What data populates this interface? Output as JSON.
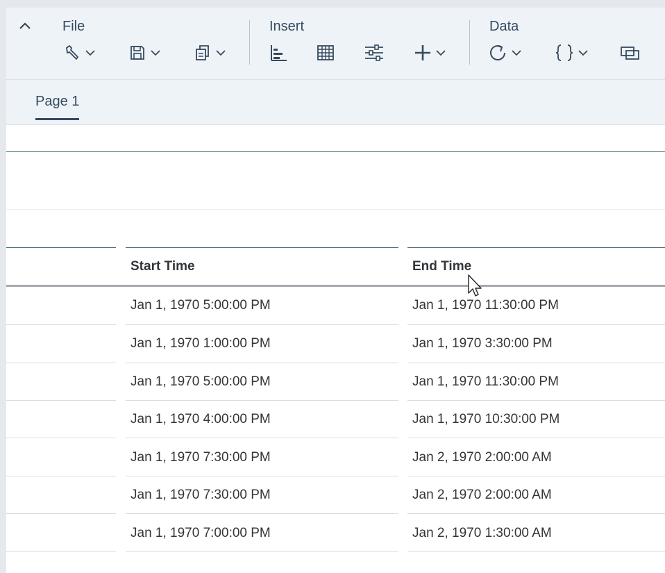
{
  "toolbar": {
    "groups": {
      "file": "File",
      "insert": "Insert",
      "data": "Data"
    },
    "icons": {
      "collapse": "chevron-up-icon",
      "file": [
        "wrench-icon",
        "save-icon",
        "copy-icon"
      ],
      "insert": [
        "bar-chart-icon",
        "table-icon",
        "filter-icon",
        "add-icon"
      ],
      "data": [
        "refresh-icon",
        "formula-icon",
        "window-icon"
      ]
    }
  },
  "tabs": [
    {
      "label": "Page 1"
    }
  ],
  "table": {
    "columns": [
      "Start Time",
      "End Time"
    ],
    "rows": [
      [
        "Jan 1, 1970 5:00:00 PM",
        "Jan 1, 1970 11:30:00 PM"
      ],
      [
        "Jan 1, 1970 1:00:00 PM",
        "Jan 1, 1970 3:30:00 PM"
      ],
      [
        "Jan 1, 1970 5:00:00 PM",
        "Jan 1, 1970 11:30:00 PM"
      ],
      [
        "Jan 1, 1970 4:00:00 PM",
        "Jan 1, 1970 10:30:00 PM"
      ],
      [
        "Jan 1, 1970 7:30:00 PM",
        "Jan 2, 1970 2:00:00 AM"
      ],
      [
        "Jan 1, 1970 7:30:00 PM",
        "Jan 2, 1970 2:00:00 AM"
      ],
      [
        "Jan 1, 1970 7:00:00 PM",
        "Jan 2, 1970 1:30:00 AM"
      ]
    ]
  },
  "colors": {
    "accent": "#354a5f",
    "toolbar_bg": "#eef3f8",
    "text": "#32363a"
  }
}
